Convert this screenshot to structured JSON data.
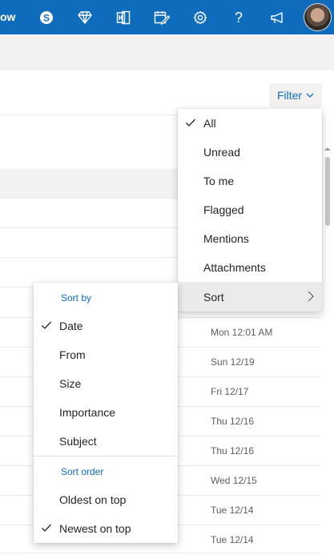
{
  "topbar": {
    "left_text": "ow",
    "icons": [
      "skype-icon",
      "diamond-icon",
      "office-icon",
      "calendar-edit-icon",
      "gear-icon",
      "help-icon",
      "megaphone-icon"
    ],
    "help_glyph": "?"
  },
  "filter_button": {
    "label": "Filter"
  },
  "filter_menu": {
    "items": [
      {
        "label": "All",
        "checked": true
      },
      {
        "label": "Unread",
        "checked": false
      },
      {
        "label": "To me",
        "checked": false
      },
      {
        "label": "Flagged",
        "checked": false
      },
      {
        "label": "Mentions",
        "checked": false
      },
      {
        "label": "Attachments",
        "checked": false
      },
      {
        "label": "Sort",
        "submenu": true,
        "highlighted": true
      }
    ]
  },
  "sort_menu": {
    "sort_by_header": "Sort by",
    "sort_by_items": [
      {
        "label": "Date",
        "checked": true
      },
      {
        "label": "From",
        "checked": false
      },
      {
        "label": "Size",
        "checked": false
      },
      {
        "label": "Importance",
        "checked": false
      },
      {
        "label": "Subject",
        "checked": false
      }
    ],
    "sort_order_header": "Sort order",
    "sort_order_items": [
      {
        "label": "Oldest on top",
        "checked": false
      },
      {
        "label": "Newest on top",
        "checked": true
      }
    ]
  },
  "message_dates": [
    "Mon 12:01 AM",
    "Sun 12/19",
    "Fri 12/17",
    "Thu 12/16",
    "Thu 12/16",
    "Wed 12/15",
    "Tue 12/14",
    "Tue 12/14"
  ],
  "colors": {
    "accent": "#0f6cbd",
    "ribbon": "#f3f2f1",
    "menu_highlight": "#edebe9"
  }
}
